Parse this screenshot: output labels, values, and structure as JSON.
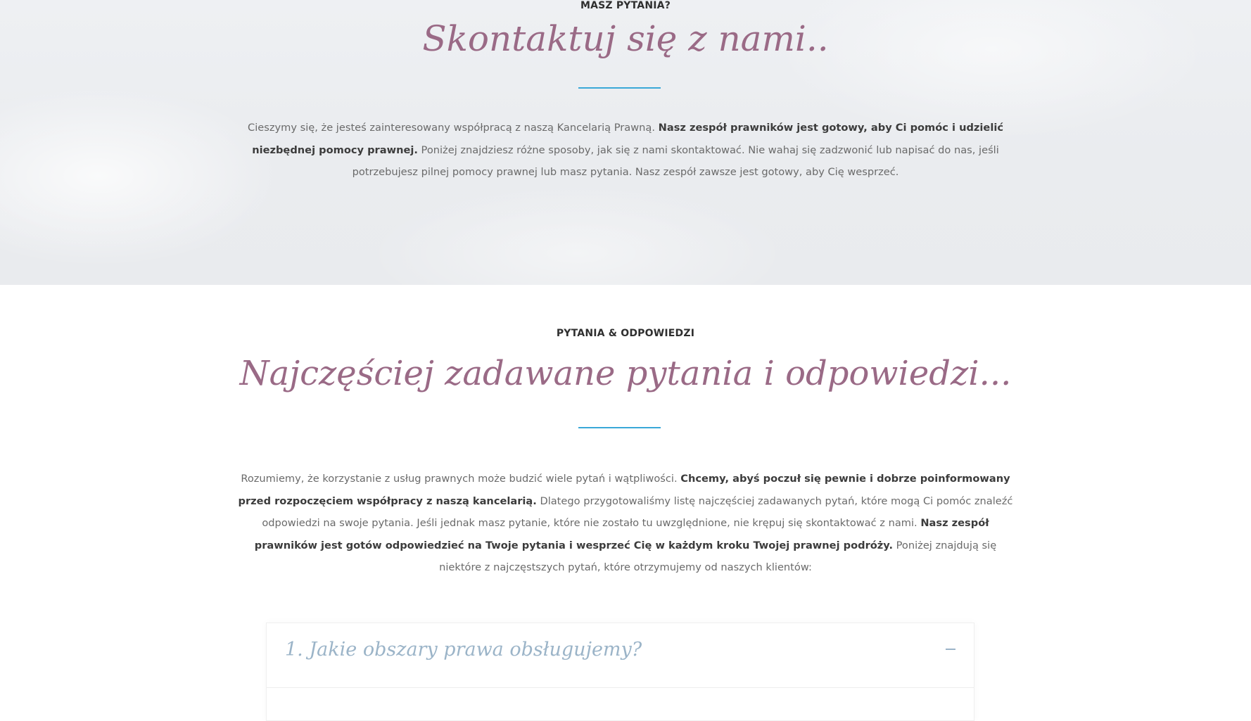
{
  "contact": {
    "kicker": "MASZ PYTANIA?",
    "title": "Skontaktuj się z nami..",
    "text_1": "Cieszymy się, że jesteś zainteresowany współpracą z naszą Kancelarią Prawną. ",
    "text_bold_1": "Nasz zespół prawników jest gotowy, aby Ci pomóc i udzielić niezbędnej pomocy prawnej.",
    "text_2": " Poniżej znajdziesz różne sposoby, jak się z nami skontaktować. Nie wahaj się zadzwonić lub napisać do nas, jeśli potrzebujesz pilnej pomocy prawnej lub masz pytania. Nasz zespół zawsze jest gotowy, aby Cię wesprzeć."
  },
  "faq": {
    "kicker": "PYTANIA & ODPOWIEDZI",
    "title": "Najczęściej zadawane pytania i odpowiedzi...",
    "text_1": "Rozumiemy, że korzystanie z usług prawnych może budzić wiele pytań i wątpliwości. ",
    "text_bold_1": "Chcemy, abyś poczuł się pewnie i dobrze poinformowany przed rozpoczęciem współpracy z naszą kancelarią.",
    "text_2": " Dlatego przygotowaliśmy listę najczęściej zadawanych pytań, które mogą Ci pomóc znaleźć odpowiedzi na swoje pytania. Jeśli jednak masz pytanie, które nie zostało tu uwzględnione, nie krępuj się skontaktować z nami. ",
    "text_bold_2": "Nasz zespół prawników jest gotów odpowiedzieć na Twoje pytania i wesprzeć Cię w każdym kroku Twojej prawnej podróży.",
    "text_3": " Poniżej znajdują się niektóre z najczęstszych pytań, które otrzymujemy od naszych klientów:",
    "items": [
      {
        "question": "1. Jakie obszary prawa obsługujemy?",
        "toggle_icon": "minus-icon",
        "expanded": true
      }
    ]
  },
  "colors": {
    "script_title": "#9a6a86",
    "divider": "#3aa8d8",
    "accordion_title": "#9bb4c8"
  }
}
